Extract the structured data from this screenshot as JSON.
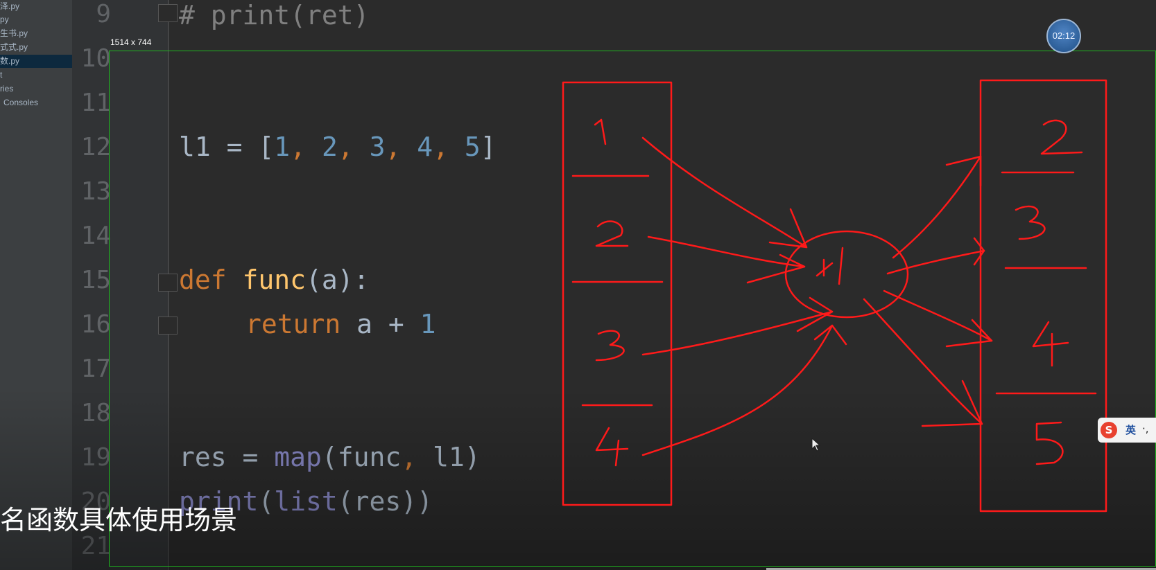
{
  "sidebar": {
    "items": [
      {
        "label": "泽.py"
      },
      {
        "label": "py"
      },
      {
        "label": "生书.py"
      },
      {
        "label": "式式.py"
      },
      {
        "label": "数.py"
      },
      {
        "label": "t"
      },
      {
        "label": "ries"
      },
      {
        "label": "Consoles"
      }
    ]
  },
  "editor": {
    "line_numbers": [
      "9",
      "10",
      "11",
      "12",
      "13",
      "14",
      "15",
      "16",
      "17",
      "18",
      "19",
      "20",
      "21"
    ],
    "lines": {
      "l9": {
        "text": "# print(ret)"
      },
      "l12": {
        "var": "l1",
        "eq": " = [",
        "n1": "1",
        "n2": "2",
        "n3": "3",
        "n4": "4",
        "n5": "5",
        "close": "]",
        "sep": ", "
      },
      "l15": {
        "kw": "def",
        "name": "func",
        "args": "(a):"
      },
      "l16": {
        "kw": "return",
        "expr": " a + ",
        "num": "1"
      },
      "l19": {
        "var": "res = ",
        "fn": "map",
        "args_open": "(func",
        "comma": ",",
        "args_rest": " l1)"
      },
      "l20": {
        "fn": "print",
        "rest_open": "(",
        "fn2": "list",
        "rest": "(res))"
      }
    }
  },
  "selection": {
    "size_label": "1514 x 744"
  },
  "timer": {
    "text": "02:12"
  },
  "subtitle": {
    "text": "名函数具体使用场景"
  },
  "ime": {
    "lang": "英",
    "punct": "·,"
  },
  "annotation": {
    "left_box": [
      "1",
      "2",
      "3",
      "4"
    ],
    "circle": "+1",
    "right_box": [
      "2",
      "3",
      "4",
      "5"
    ],
    "stroke_color": "#ff1a1a"
  }
}
